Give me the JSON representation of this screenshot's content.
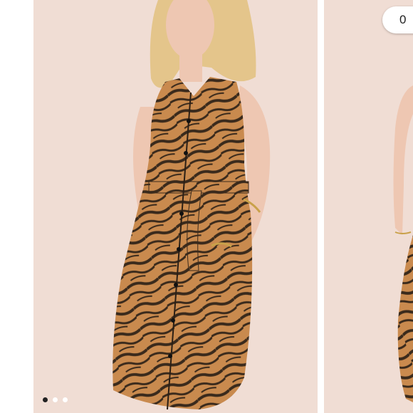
{
  "like_button": {
    "count": "0"
  },
  "carousel": {
    "slides": [
      {
        "alt": "tiger-stripe-shirt-dress-front"
      },
      {
        "alt": "tiger-stripe-shirt-dress-side"
      }
    ],
    "active_index": 0,
    "dot_count": 3
  },
  "colors": {
    "background": "#f0ddd4",
    "dress_base": "#c98a4e",
    "stripe": "#3a2a1c",
    "skin": "#eec7b2",
    "hair": "#e4c58b",
    "active_dot": "#222222",
    "inactive_dot": "#ffffff"
  }
}
